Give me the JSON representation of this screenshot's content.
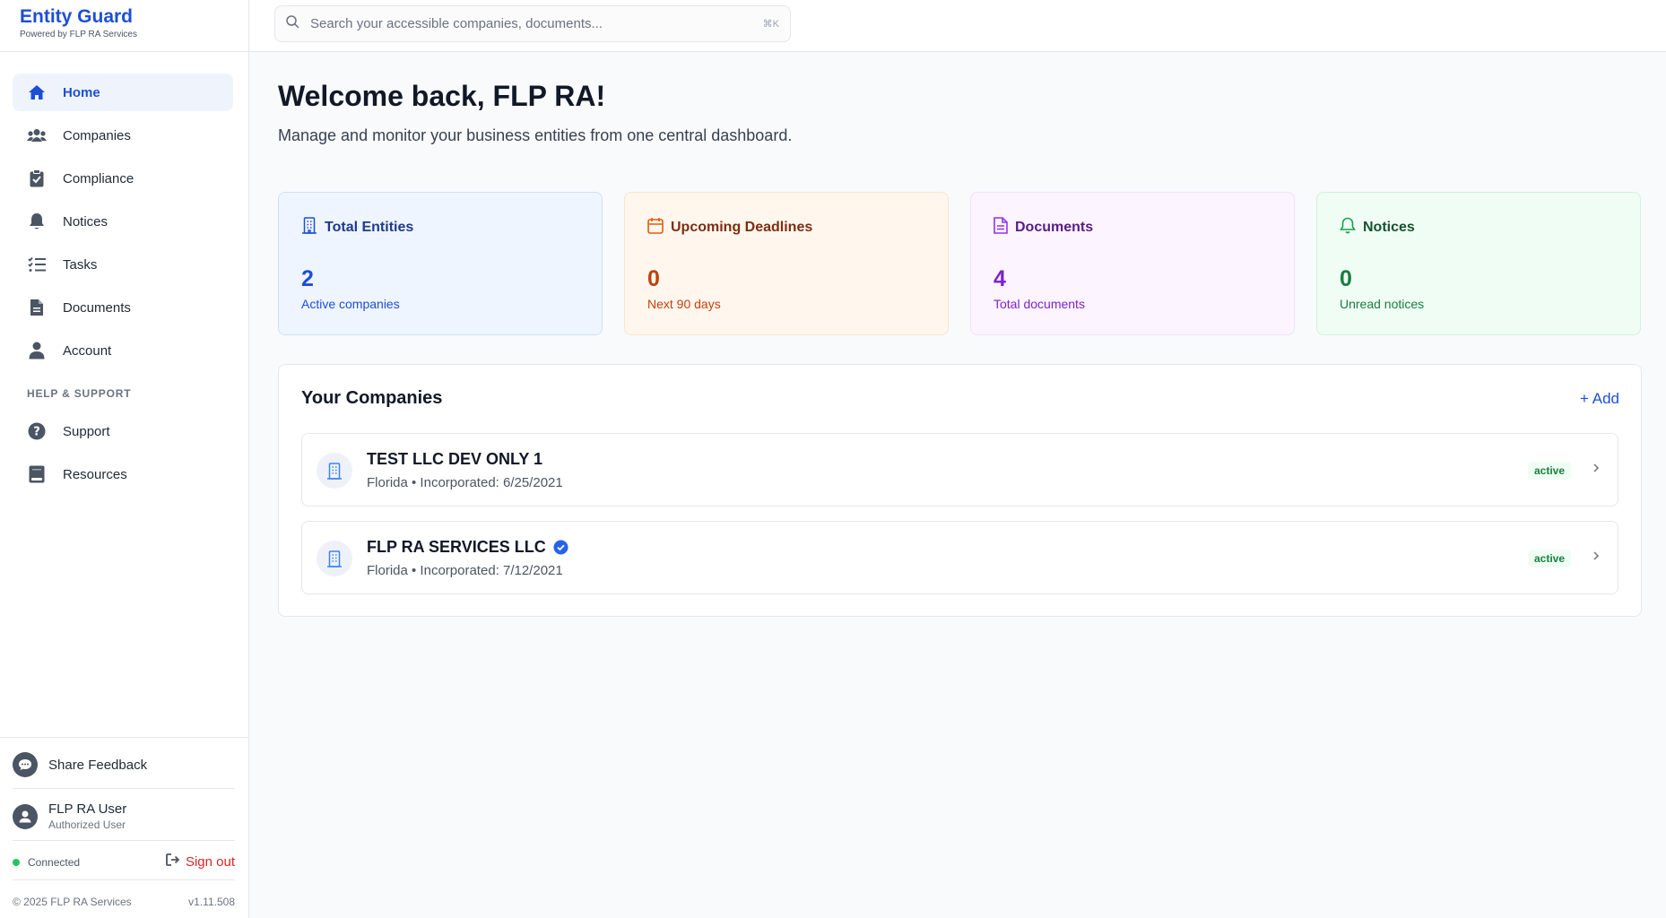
{
  "brand": {
    "title": "Entity Guard",
    "subtitle": "Powered by FLP RA Services"
  },
  "search": {
    "placeholder": "Search your accessible companies, documents...",
    "shortcut": "⌘K"
  },
  "sidebar": {
    "items": [
      {
        "label": "Home",
        "icon": "home-icon",
        "active": true
      },
      {
        "label": "Companies",
        "icon": "users-icon"
      },
      {
        "label": "Compliance",
        "icon": "clipboard-check-icon"
      },
      {
        "label": "Notices",
        "icon": "bell-icon"
      },
      {
        "label": "Tasks",
        "icon": "list-check-icon"
      },
      {
        "label": "Documents",
        "icon": "file-icon"
      },
      {
        "label": "Account",
        "icon": "user-icon"
      }
    ],
    "help_section": "HELP & SUPPORT",
    "help_items": [
      {
        "label": "Support",
        "icon": "question-circle-icon"
      },
      {
        "label": "Resources",
        "icon": "book-icon"
      }
    ],
    "feedback_label": "Share Feedback",
    "user": {
      "name": "FLP RA User",
      "role": "Authorized User"
    },
    "connection_status": "Connected",
    "signout_label": "Sign out",
    "copyright": "© 2025 FLP RA Services",
    "version": "v1.11.508"
  },
  "main": {
    "welcome": "Welcome back, FLP RA!",
    "subtitle": "Manage and monitor your business entities from one central dashboard.",
    "stats": [
      {
        "title": "Total Entities",
        "value": "2",
        "desc": "Active companies",
        "icon": "building-icon",
        "color": "#1d4ed8"
      },
      {
        "title": "Upcoming Deadlines",
        "value": "0",
        "desc": "Next 90 days",
        "icon": "calendar-icon",
        "color": "#c2410c"
      },
      {
        "title": "Documents",
        "value": "4",
        "desc": "Total documents",
        "icon": "document-icon",
        "color": "#7e22ce"
      },
      {
        "title": "Notices",
        "value": "0",
        "desc": "Unread notices",
        "icon": "bell-icon",
        "color": "#15803d"
      }
    ],
    "companies": {
      "title": "Your Companies",
      "add_label": "+ Add",
      "rows": [
        {
          "name": "TEST LLC DEV ONLY 1",
          "meta": "Florida • Incorporated: 6/25/2021",
          "status": "active",
          "verified": false
        },
        {
          "name": "FLP RA SERVICES LLC",
          "meta": "Florida • Incorporated: 7/12/2021",
          "status": "active",
          "verified": true
        }
      ]
    }
  },
  "colors": {
    "accent": "#1d4ed8",
    "danger": "#dc2626",
    "success": "#22c55e"
  }
}
